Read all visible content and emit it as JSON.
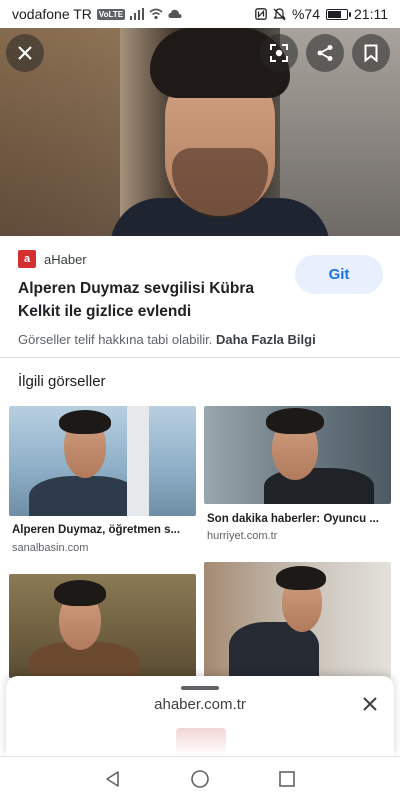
{
  "status_bar": {
    "carrier": "vodafone TR",
    "network_badge": "VoLTE",
    "battery": "%74",
    "battery_level": 0.74,
    "time": "21:11",
    "icons": [
      "signal-icon",
      "wifi-icon",
      "cloud-icon",
      "nfc-icon",
      "mute-icon",
      "battery-icon"
    ]
  },
  "hero": {
    "buttons": [
      "close-icon",
      "lens-icon",
      "share-icon",
      "bookmark-icon"
    ]
  },
  "source": {
    "logo_text": "a",
    "name": "aHaber",
    "headline": "Alperen Duymaz sevgilisi Kübra Kelkit ile gizlice evlendi",
    "go_label": "Git",
    "copyright": "Görseller telif hakkına tabi olabilir.",
    "more_info": "Daha Fazla Bilgi"
  },
  "related": {
    "title": "İlgili görseller",
    "items": [
      {
        "caption": "Alperen Duymaz, öğretmen s...",
        "domain": "sanalbasin.com"
      },
      {
        "caption": "Son dakika haberler: Oyuncu ...",
        "domain": "hurriyet.com.tr"
      },
      {
        "caption": "",
        "domain": ""
      },
      {
        "caption": "",
        "domain": ""
      }
    ]
  },
  "sheet": {
    "url": "ahaber.com.tr"
  },
  "navbar": {
    "icons": [
      "back-icon",
      "home-icon",
      "recents-icon"
    ]
  },
  "colors": {
    "accent": "#1a73e8",
    "go_bg": "#e8f0fe",
    "brand_red": "#d32f2f"
  }
}
